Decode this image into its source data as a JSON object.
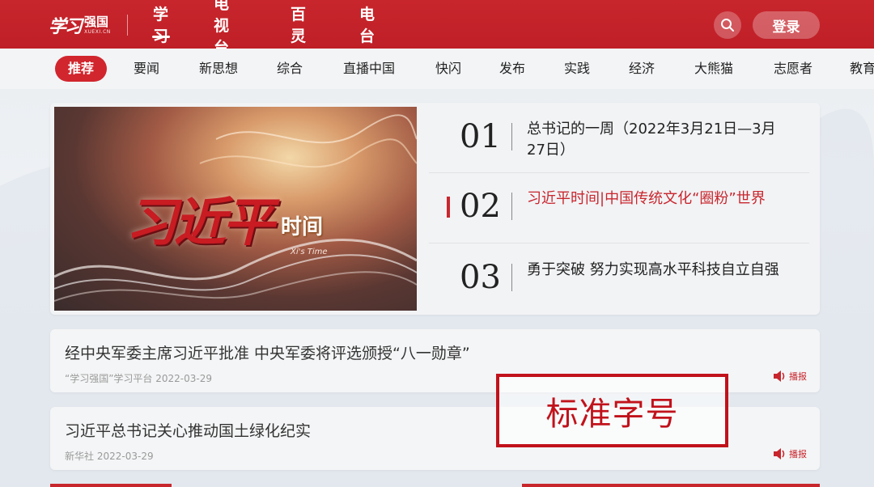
{
  "header": {
    "logo_script": "学习",
    "logo_main": "强国",
    "logo_sub": "XUEXI.CN",
    "nav": [
      {
        "label": "学习",
        "active": true
      },
      {
        "label": "电视台",
        "active": false
      },
      {
        "label": "百灵",
        "active": false
      },
      {
        "label": "电台",
        "active": false
      }
    ],
    "login_label": "登录",
    "icons": {
      "search": "search-icon"
    }
  },
  "categories": [
    {
      "label": "推荐",
      "active": true
    },
    {
      "label": "要闻"
    },
    {
      "label": "新思想"
    },
    {
      "label": "综合"
    },
    {
      "label": "直播中国"
    },
    {
      "label": "快闪"
    },
    {
      "label": "发布"
    },
    {
      "label": "实践"
    },
    {
      "label": "经济"
    },
    {
      "label": "大熊猫"
    },
    {
      "label": "志愿者"
    },
    {
      "label": "教育"
    }
  ],
  "feature": {
    "image_title": "习近平",
    "image_badge": "时间",
    "image_subtitle": "Xi's Time",
    "ranking": [
      {
        "num": "01",
        "text": "总书记的一周（2022年3月21日—3月27日）",
        "highlight": false
      },
      {
        "num": "02",
        "text": "习近平时间|中国传统文化“圈粉”世界",
        "highlight": true
      },
      {
        "num": "03",
        "text": "勇于突破  努力实现高水平科技自立自强",
        "highlight": false
      }
    ]
  },
  "news": [
    {
      "title": "经中央军委主席习近平批准  中央军委将评选颁授“八一勋章”",
      "source": "“学习强国”学习平台",
      "date": "2022-03-29",
      "play_label": "播报"
    },
    {
      "title": "习近平总书记关心推动国土绿化纪实",
      "source": "新华社",
      "date": "2022-03-29",
      "play_label": "播报"
    }
  ],
  "annotation": {
    "text": "标准字号"
  },
  "colors": {
    "brand_red": "#c8262d",
    "annotation_red": "#c1121b"
  }
}
